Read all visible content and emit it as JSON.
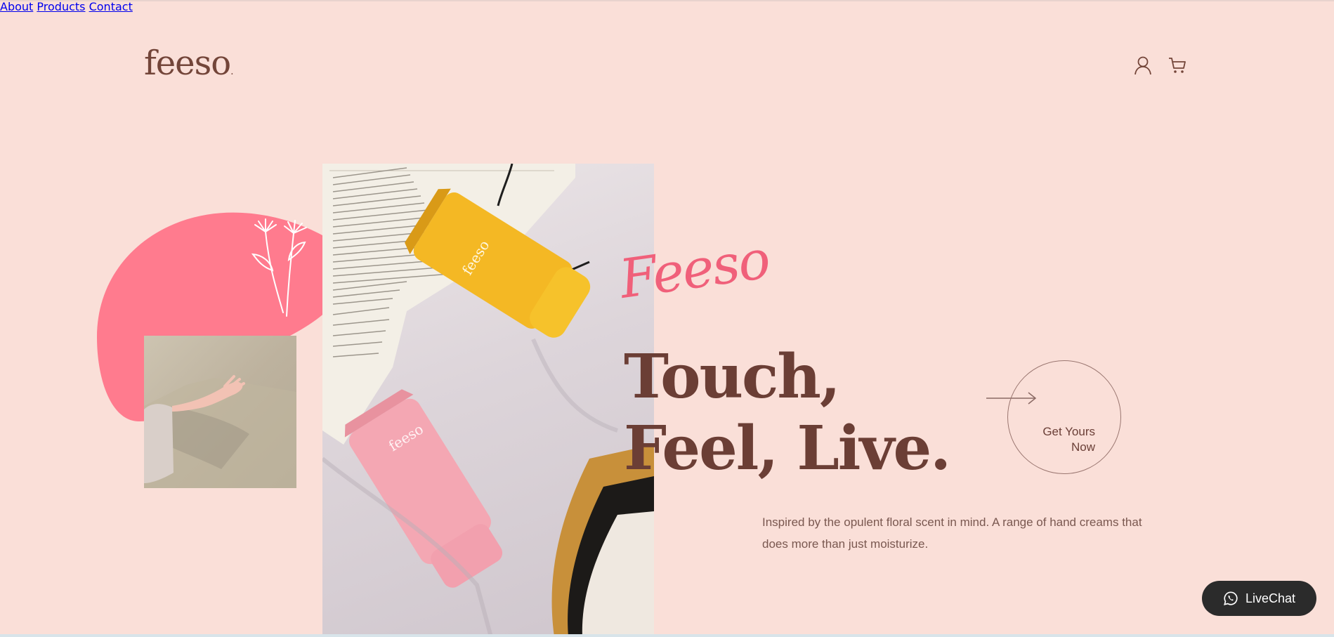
{
  "brand": {
    "logo": "feeso",
    "logo_dot": "."
  },
  "nav": {
    "items": [
      "About",
      "Products",
      "Contact"
    ]
  },
  "icons": {
    "account": "user-icon",
    "cart": "cart-icon",
    "chat": "whatsapp-icon"
  },
  "hero": {
    "script_text": "Feeso",
    "headline_line1": "Touch,",
    "headline_line2": "Feel, Live.",
    "cta_line1": "Get Yours",
    "cta_line2": "Now",
    "description": "Inspired by the opulent floral scent in mind. A range of hand creams that does more than just moisturize."
  },
  "product_labels": {
    "yellow_tube": "feeso",
    "pink_tube": "feeso"
  },
  "livechat": {
    "label": "LiveChat"
  },
  "colors": {
    "background": "#fadfd8",
    "brand_brown": "#734539",
    "accent_pink": "#f0607a",
    "blob_pink": "#ff7b8e",
    "chat_bg": "#2b2b2b"
  }
}
